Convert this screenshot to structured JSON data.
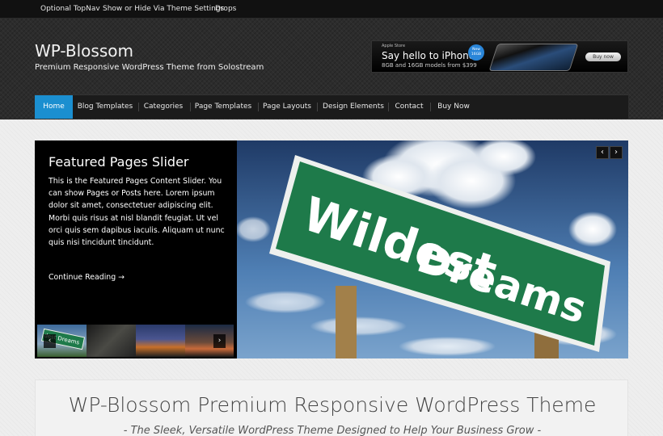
{
  "topnav": {
    "items": [
      "Optional TopNav",
      "Show or Hide Via Theme Settings",
      "Drops"
    ]
  },
  "header": {
    "title": "WP-Blossom",
    "description": "Premium Responsive WordPress Theme from Solostream"
  },
  "ad": {
    "brand": "Apple Store",
    "headline": "Say hello to iPhone.",
    "subline": "8GB and 16GB models from $399",
    "badge": "New 16GB",
    "cta": "Buy now"
  },
  "mainnav": {
    "items": [
      "Home",
      "Blog Templates",
      "Categories",
      "Page Templates",
      "Page Layouts",
      "Design Elements",
      "Contact",
      "Buy Now"
    ],
    "active_index": 0
  },
  "slider": {
    "title": "Featured Pages Slider",
    "text": "This is the Featured Pages Content Slider. You can show Pages or Posts here. Lorem ipsum dolor sit amet, consectetuer adipiscing elit. Morbi quis risus at nisl blandit feugiat. Ut vel orci quis sem dapibus iaculis. Aliquam ut nunc quis nisi tincidunt tincidunt.",
    "more": "Continue Reading →",
    "image_sign_line1": "Wildest",
    "image_sign_line2": "Dreams",
    "thumb_label": "dest Dreams",
    "prev_arrow": "‹",
    "next_arrow": "›"
  },
  "intro": {
    "title": "WP-Blossom Premium Responsive WordPress Theme",
    "subtitle": "- The Sleek, Versatile WordPress Theme Designed to Help Your Business Grow -"
  },
  "colors": {
    "accent": "#1b8fd0",
    "header_bg": "#2c2c2c",
    "topnav_bg": "#111111",
    "sign_green": "#1e7a4a"
  }
}
